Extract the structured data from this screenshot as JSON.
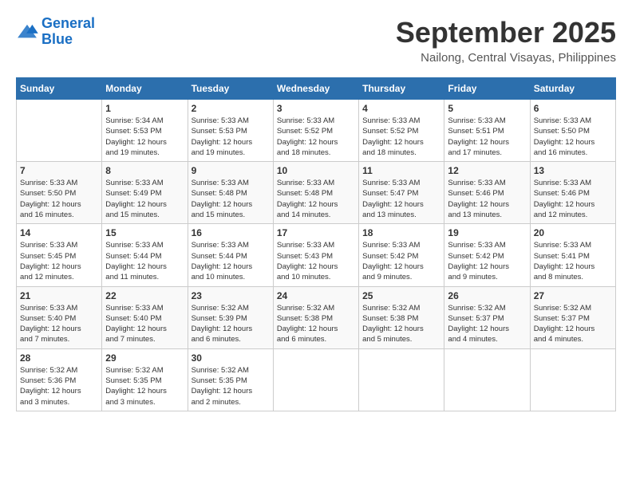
{
  "logo": {
    "line1": "General",
    "line2": "Blue"
  },
  "title": "September 2025",
  "location": "Nailong, Central Visayas, Philippines",
  "weekdays": [
    "Sunday",
    "Monday",
    "Tuesday",
    "Wednesday",
    "Thursday",
    "Friday",
    "Saturday"
  ],
  "weeks": [
    [
      {
        "day": "",
        "info": ""
      },
      {
        "day": "1",
        "info": "Sunrise: 5:34 AM\nSunset: 5:53 PM\nDaylight: 12 hours\nand 19 minutes."
      },
      {
        "day": "2",
        "info": "Sunrise: 5:33 AM\nSunset: 5:53 PM\nDaylight: 12 hours\nand 19 minutes."
      },
      {
        "day": "3",
        "info": "Sunrise: 5:33 AM\nSunset: 5:52 PM\nDaylight: 12 hours\nand 18 minutes."
      },
      {
        "day": "4",
        "info": "Sunrise: 5:33 AM\nSunset: 5:52 PM\nDaylight: 12 hours\nand 18 minutes."
      },
      {
        "day": "5",
        "info": "Sunrise: 5:33 AM\nSunset: 5:51 PM\nDaylight: 12 hours\nand 17 minutes."
      },
      {
        "day": "6",
        "info": "Sunrise: 5:33 AM\nSunset: 5:50 PM\nDaylight: 12 hours\nand 16 minutes."
      }
    ],
    [
      {
        "day": "7",
        "info": "Sunrise: 5:33 AM\nSunset: 5:50 PM\nDaylight: 12 hours\nand 16 minutes."
      },
      {
        "day": "8",
        "info": "Sunrise: 5:33 AM\nSunset: 5:49 PM\nDaylight: 12 hours\nand 15 minutes."
      },
      {
        "day": "9",
        "info": "Sunrise: 5:33 AM\nSunset: 5:48 PM\nDaylight: 12 hours\nand 15 minutes."
      },
      {
        "day": "10",
        "info": "Sunrise: 5:33 AM\nSunset: 5:48 PM\nDaylight: 12 hours\nand 14 minutes."
      },
      {
        "day": "11",
        "info": "Sunrise: 5:33 AM\nSunset: 5:47 PM\nDaylight: 12 hours\nand 13 minutes."
      },
      {
        "day": "12",
        "info": "Sunrise: 5:33 AM\nSunset: 5:46 PM\nDaylight: 12 hours\nand 13 minutes."
      },
      {
        "day": "13",
        "info": "Sunrise: 5:33 AM\nSunset: 5:46 PM\nDaylight: 12 hours\nand 12 minutes."
      }
    ],
    [
      {
        "day": "14",
        "info": "Sunrise: 5:33 AM\nSunset: 5:45 PM\nDaylight: 12 hours\nand 12 minutes."
      },
      {
        "day": "15",
        "info": "Sunrise: 5:33 AM\nSunset: 5:44 PM\nDaylight: 12 hours\nand 11 minutes."
      },
      {
        "day": "16",
        "info": "Sunrise: 5:33 AM\nSunset: 5:44 PM\nDaylight: 12 hours\nand 10 minutes."
      },
      {
        "day": "17",
        "info": "Sunrise: 5:33 AM\nSunset: 5:43 PM\nDaylight: 12 hours\nand 10 minutes."
      },
      {
        "day": "18",
        "info": "Sunrise: 5:33 AM\nSunset: 5:42 PM\nDaylight: 12 hours\nand 9 minutes."
      },
      {
        "day": "19",
        "info": "Sunrise: 5:33 AM\nSunset: 5:42 PM\nDaylight: 12 hours\nand 9 minutes."
      },
      {
        "day": "20",
        "info": "Sunrise: 5:33 AM\nSunset: 5:41 PM\nDaylight: 12 hours\nand 8 minutes."
      }
    ],
    [
      {
        "day": "21",
        "info": "Sunrise: 5:33 AM\nSunset: 5:40 PM\nDaylight: 12 hours\nand 7 minutes."
      },
      {
        "day": "22",
        "info": "Sunrise: 5:33 AM\nSunset: 5:40 PM\nDaylight: 12 hours\nand 7 minutes."
      },
      {
        "day": "23",
        "info": "Sunrise: 5:32 AM\nSunset: 5:39 PM\nDaylight: 12 hours\nand 6 minutes."
      },
      {
        "day": "24",
        "info": "Sunrise: 5:32 AM\nSunset: 5:38 PM\nDaylight: 12 hours\nand 6 minutes."
      },
      {
        "day": "25",
        "info": "Sunrise: 5:32 AM\nSunset: 5:38 PM\nDaylight: 12 hours\nand 5 minutes."
      },
      {
        "day": "26",
        "info": "Sunrise: 5:32 AM\nSunset: 5:37 PM\nDaylight: 12 hours\nand 4 minutes."
      },
      {
        "day": "27",
        "info": "Sunrise: 5:32 AM\nSunset: 5:37 PM\nDaylight: 12 hours\nand 4 minutes."
      }
    ],
    [
      {
        "day": "28",
        "info": "Sunrise: 5:32 AM\nSunset: 5:36 PM\nDaylight: 12 hours\nand 3 minutes."
      },
      {
        "day": "29",
        "info": "Sunrise: 5:32 AM\nSunset: 5:35 PM\nDaylight: 12 hours\nand 3 minutes."
      },
      {
        "day": "30",
        "info": "Sunrise: 5:32 AM\nSunset: 5:35 PM\nDaylight: 12 hours\nand 2 minutes."
      },
      {
        "day": "",
        "info": ""
      },
      {
        "day": "",
        "info": ""
      },
      {
        "day": "",
        "info": ""
      },
      {
        "day": "",
        "info": ""
      }
    ]
  ]
}
